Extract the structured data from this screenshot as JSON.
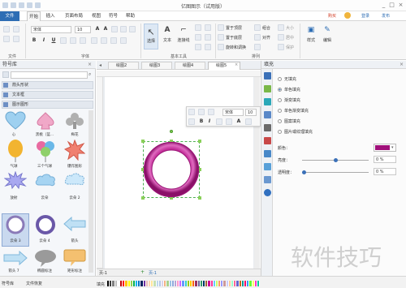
{
  "app": {
    "title": "亿图图示（试用版）",
    "header_links": [
      "购买",
      "登录",
      "发布"
    ],
    "window_controls": [
      "_",
      "□",
      "×"
    ]
  },
  "ribbon_tabs": {
    "file": "文件",
    "start": "开始",
    "insert": "插入",
    "page_layout": "页面布局",
    "view": "视图",
    "symbol": "符号",
    "help": "帮助"
  },
  "ribbon": {
    "font_name": "宋体",
    "font_size": "10",
    "tools": {
      "select": "选择",
      "text": "文本",
      "connector": "连接线"
    },
    "arrange": {
      "bring_front": "置于顶层",
      "send_back": "置于底层",
      "rotate": "旋转和调换",
      "align": "组合",
      "distribute": "对齐",
      "size": "大小",
      "center": "居中",
      "protect": "保护"
    },
    "style": "样式",
    "edit": "编辑",
    "group_labels": {
      "file": "文件",
      "font": "字体",
      "basic_tools": "基本工具",
      "arrange": "排列"
    }
  },
  "library": {
    "title": "符号库",
    "search_placeholder": "",
    "sections": [
      "箭头形状",
      "文本框",
      "图示图形"
    ],
    "shapes": [
      {
        "label": "心"
      },
      {
        "label": "黑桃（蓝..."
      },
      {
        "label": "梅花"
      },
      {
        "label": "气球"
      },
      {
        "label": "三个气球"
      },
      {
        "label": "爆炸图形"
      },
      {
        "label": "放射"
      },
      {
        "label": "云朵"
      },
      {
        "label": "云朵 2"
      },
      {
        "label": "云朵 3"
      },
      {
        "label": "云朵 4"
      },
      {
        "label": "箭头"
      },
      {
        "label": "箭头 7"
      },
      {
        "label": "椭圆标注"
      },
      {
        "label": "矩形标注"
      }
    ],
    "bottom_tabs": [
      "符号库",
      "文件恢复"
    ]
  },
  "doc_tabs": [
    "绘图2",
    "绘图3",
    "绘图4",
    "绘图5"
  ],
  "float_toolbar": {
    "font": "宋体",
    "size": "10"
  },
  "fill_panel": {
    "title": "填充",
    "options": [
      "无填充",
      "单色填充",
      "渐变填充",
      "单色渐变填充",
      "图案填充",
      "图片或纹理填充"
    ],
    "selected_index": 1,
    "color_label": "颜色：",
    "color_value": "#a0107a",
    "brightness_label": "亮度：",
    "brightness_value": "0 %",
    "transparency_label": "透明度：",
    "transparency_value": "0 %"
  },
  "page_tabs": {
    "current": "页-1",
    "second": "页-1"
  },
  "status": {
    "fill_label": "填充"
  },
  "palette": [
    "#000000",
    "#3f3f3f",
    "#7f7f7f",
    "#bfbfbf",
    "#ffffff",
    "#c00000",
    "#ff0000",
    "#ffc000",
    "#ffff00",
    "#92d050",
    "#00b050",
    "#00b0f0",
    "#0070c0",
    "#002060",
    "#7030a0",
    "#e6b8b7",
    "#fcd5b4",
    "#ffe699",
    "#c6e0b4",
    "#bdd7ee",
    "#b4c6e7",
    "#d9d2e9",
    "#f4b183",
    "#a9d08e",
    "#9bc2e6",
    "#8ea9db",
    "#b4a7d6",
    "#ff99cc",
    "#cc66ff",
    "#6699ff",
    "#33cccc",
    "#99cc00",
    "#ffcc00",
    "#ff6600",
    "#993366",
    "#666699",
    "#339966",
    "#003366",
    "#996633",
    "#cc0099",
    "#ff3399",
    "#66ccff",
    "#ccff66",
    "#ff9966",
    "#9999ff",
    "#cc9999",
    "#ccccff",
    "#ffcc99",
    "#99ffcc",
    "#ff6699",
    "#6666cc",
    "#cc6600",
    "#009999",
    "#ff0066",
    "#3399ff",
    "#66ff33",
    "#ffff66",
    "#ff33cc",
    "#00cc99"
  ]
}
